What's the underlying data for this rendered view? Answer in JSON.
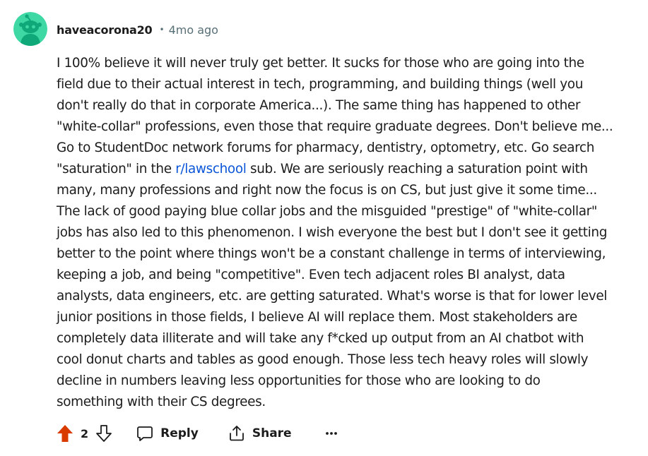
{
  "comment": {
    "author": "haveacorona20",
    "separator": "•",
    "timestamp": "4mo ago",
    "subreddit_link": "r/lawschool",
    "lines": [
      {
        "text": "I 100% believe it will never truly get better. It sucks for those who are going into the"
      },
      {
        "text": "field due to their actual interest in tech, programming, and building things (well you"
      },
      {
        "text": "don't really do that in corporate America...). The same thing has happened to other"
      },
      {
        "text": "\"white-collar\" professions, even those that require graduate degrees. Don't believe me..."
      },
      {
        "text": "Go to StudentDoc network forums for pharmacy, dentistry, optometry, etc. Go search"
      },
      {
        "before": "\"saturation\" in the ",
        "after": " sub. We are seriously reaching a saturation point with"
      },
      {
        "text": "many, many professions and right now the focus is on CS, but just give it some time..."
      },
      {
        "text": "The lack of good paying blue collar jobs and the misguided \"prestige\" of \"white-collar\""
      },
      {
        "text": "jobs has also led to this phenomenon. I wish everyone the best but I don't see it getting"
      },
      {
        "text": "better to the point where things won't be a constant challenge in terms of interviewing,"
      },
      {
        "text": "keeping a job, and being \"competitive\". Even tech adjacent roles BI analyst, data"
      },
      {
        "text": "analysts, data engineers, etc. are getting saturated. What's worse is that for lower level"
      },
      {
        "text": "junior positions in those fields, I believe AI will replace them. Most stakeholders are"
      },
      {
        "text": "completely data illiterate and will take any f*cked up output from an AI chatbot with"
      },
      {
        "text": "cool donut charts and tables as good enough. Those less tech heavy roles will slowly"
      },
      {
        "text": "decline in numbers leaving less opportunities for those who are looking to do"
      },
      {
        "text": "something with their CS degrees."
      }
    ]
  },
  "actions": {
    "score": "2",
    "reply_label": "Reply",
    "share_label": "Share"
  },
  "icons": {
    "avatar": "reddit-snoo-avatar-icon",
    "upvote": "upvote-arrow-icon",
    "downvote": "downvote-arrow-icon",
    "reply": "speech-bubble-icon",
    "share": "share-arrow-icon",
    "more": "ellipsis-icon"
  },
  "colors": {
    "avatar_bg": "#3ed8a4",
    "avatar_body": "#0fa878",
    "upvote_active": "#d93a00",
    "link": "#0a55d8",
    "meta_text": "#576f76"
  }
}
